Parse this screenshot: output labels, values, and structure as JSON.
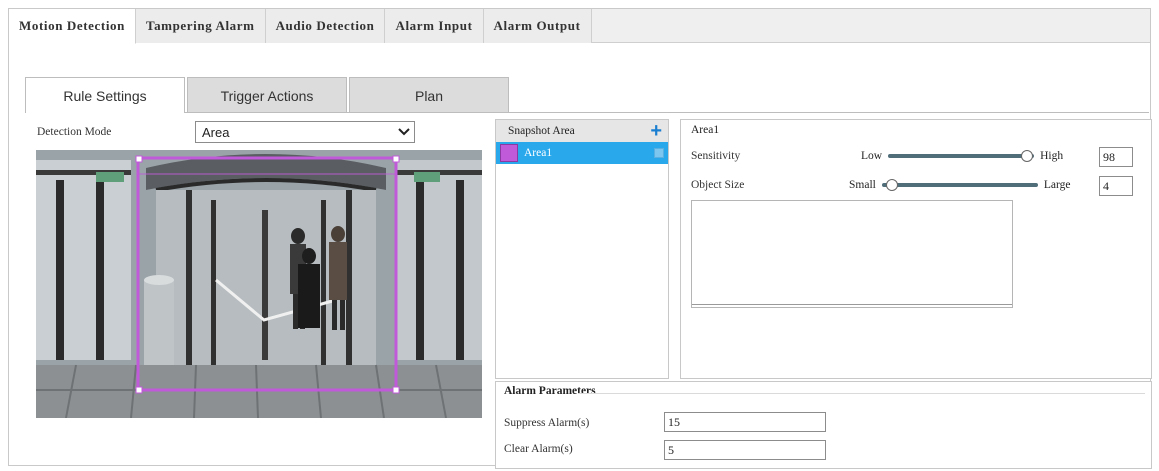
{
  "top_tabs": [
    {
      "label": "Motion Detection",
      "active": true
    },
    {
      "label": "Tampering Alarm",
      "active": false
    },
    {
      "label": "Audio Detection",
      "active": false
    },
    {
      "label": "Alarm Input",
      "active": false
    },
    {
      "label": "Alarm Output",
      "active": false
    }
  ],
  "sub_tabs": [
    {
      "label": "Rule Settings",
      "active": true
    },
    {
      "label": "Trigger Actions",
      "active": false
    },
    {
      "label": "Plan",
      "active": false
    }
  ],
  "detection_mode": {
    "label": "Detection Mode",
    "value": "Area"
  },
  "snapshot_area": {
    "header": "Snapshot Area",
    "items": [
      {
        "label": "Area1",
        "color": "#c05ad8",
        "selected": true
      }
    ]
  },
  "area_settings": {
    "title": "Area1",
    "sensitivity": {
      "label": "Sensitivity",
      "min_label": "Low",
      "max_label": "High",
      "value": "98",
      "fraction": 0.98
    },
    "object_size": {
      "label": "Object Size",
      "min_label": "Small",
      "max_label": "Large",
      "value": "4",
      "fraction": 0.04
    }
  },
  "alarm_parameters": {
    "title": "Alarm Parameters",
    "suppress_label": "Suppress Alarm(s)",
    "suppress_value": "15",
    "clear_label": "Clear Alarm(s)",
    "clear_value": "5"
  },
  "colors": {
    "accent": "#2aa8ec",
    "region": "#c05ad8",
    "add": "#1a7fd0"
  }
}
